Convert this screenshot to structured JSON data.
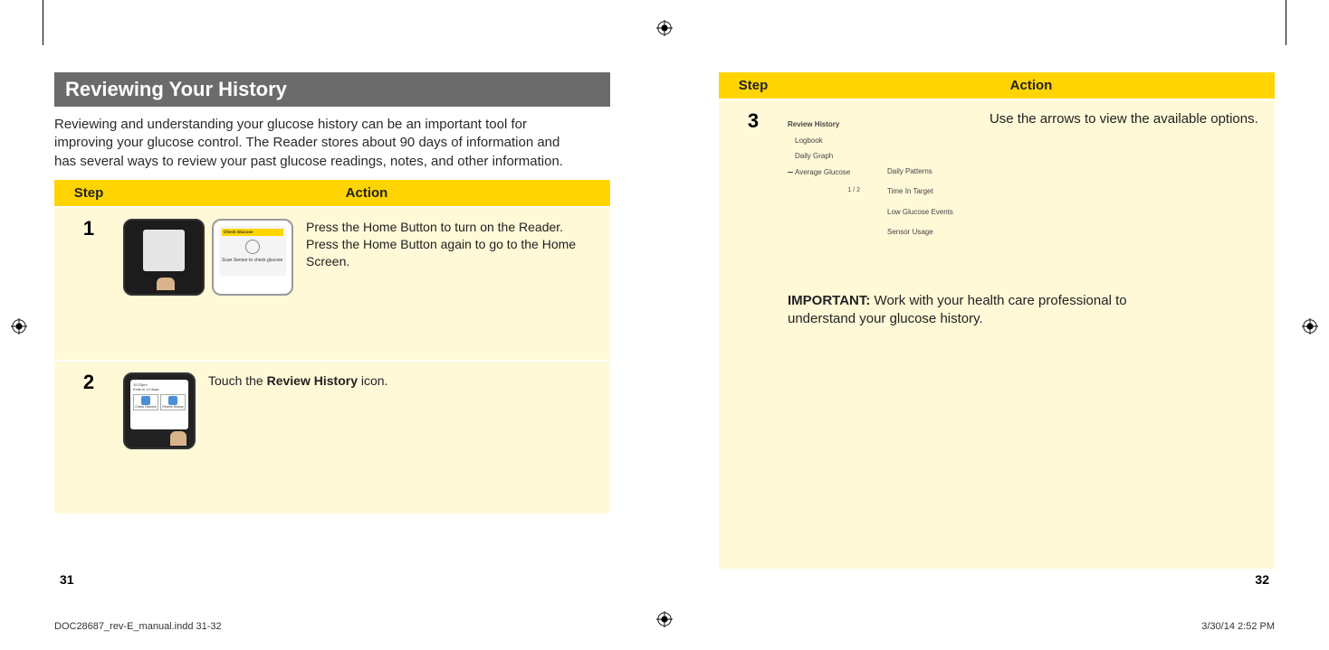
{
  "left_page": {
    "section_title": "Reviewing Your History",
    "intro": "Reviewing and understanding your glucose history can be an important tool for improving your glucose control. The Reader stores about 90 days of information and has several ways to review your past glucose readings, notes, and other information.",
    "table_head": {
      "step": "Step",
      "action": "Action"
    },
    "step1": {
      "num": "1",
      "screen_title": "Check Glucose",
      "screen_text": "Scan Sensor to check glucose",
      "desc": "Press the Home Button to turn on the Reader. Press the Home Button again to go to the Home Screen."
    },
    "step2": {
      "num": "2",
      "home_screen": {
        "line1": "10:23pm",
        "line2": "Ends in 14 days",
        "btn1": "Check Glucose",
        "btn2": "Review History"
      },
      "desc_pre": "Touch the ",
      "desc_bold": "Review History",
      "desc_post": " icon."
    },
    "page_num": "31"
  },
  "right_page": {
    "table_head": {
      "step": "Step",
      "action": "Action"
    },
    "step3": {
      "num": "3",
      "menu": {
        "title": "Review History",
        "items": [
          "Logbook",
          "Daily Graph",
          "Average Glucose"
        ],
        "page": "1 / 2",
        "options": [
          "Daily Patterns",
          "Time In Target",
          "Low Glucose Events",
          "Sensor Usage"
        ]
      },
      "desc": "Use the arrows to view the available options.",
      "important_label": "IMPORTANT:",
      "important_text": " Work with your health care professional to understand your glucose history."
    },
    "page_num": "32"
  },
  "footer": {
    "doc": "DOC28687_rev-E_manual.indd   31-32",
    "date": "3/30/14   2:52 PM"
  }
}
